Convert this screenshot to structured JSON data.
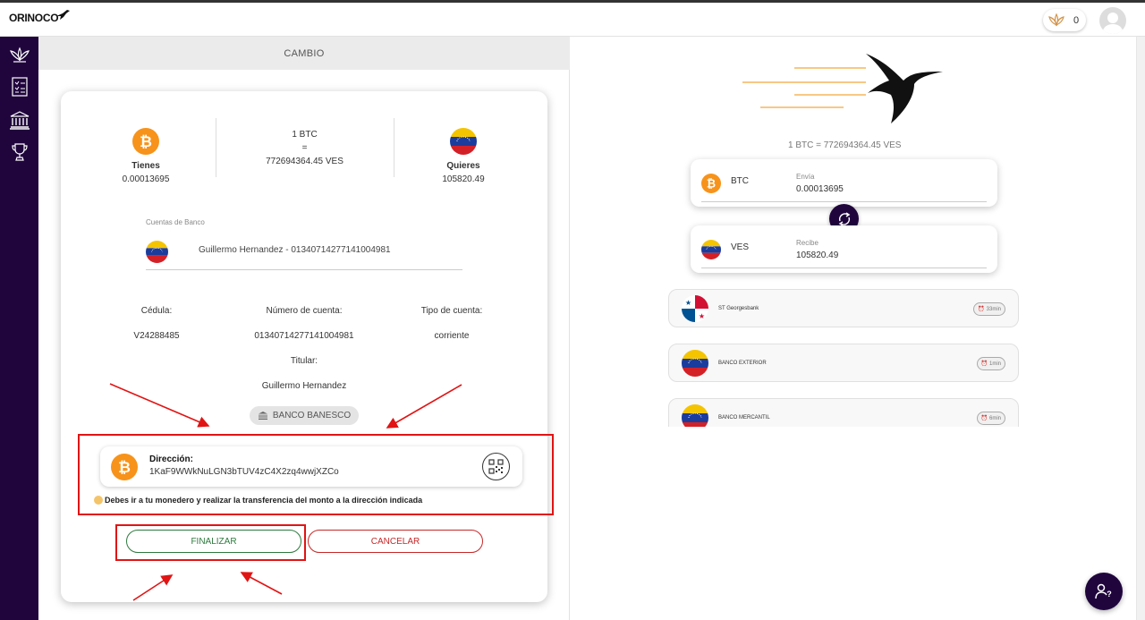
{
  "header": {
    "logo_text": "ORINOCO",
    "coins": "0"
  },
  "sidebar": {
    "items": [
      {
        "icon": "lotus-icon"
      },
      {
        "icon": "checklist-icon"
      },
      {
        "icon": "bank-icon"
      },
      {
        "icon": "trophy-icon"
      }
    ]
  },
  "exchange": {
    "section_title": "CAMBIO",
    "have_label": "Tienes",
    "have_amount": "0.00013695",
    "rate_line1": "1 BTC",
    "rate_equals": "=",
    "rate_line2": "772694364.45 VES",
    "want_label": "Quieres",
    "want_amount": "105820.49",
    "bank_accounts_label": "Cuentas de Banco",
    "selected_account": "Guillermo Hernandez - 01340714277141004981",
    "cedula_label": "Cédula:",
    "cedula_value": "V24288485",
    "account_number_label": "Número de cuenta:",
    "account_number_value": "01340714277141004981",
    "account_type_label": "Tipo de cuenta:",
    "account_type_value": "corriente",
    "holder_label": "Titular:",
    "holder_value": "Guillermo Hernandez",
    "bank_name": "BANCO BANESCO",
    "address_title": "Dirección:",
    "address_value": "1KaF9WWkNuLGN3bTUV4zC4X2zq4wwjXZCo",
    "warning": "Debes ir a tu monedero y realizar la transferencia del monto a la dirección indicada",
    "finish_label": "FINALIZAR",
    "cancel_label": "CANCELAR"
  },
  "converter": {
    "rate": "1 BTC = 772694364.45 VES",
    "send_currency": "BTC",
    "send_label": "Envía",
    "send_amount": "0.00013695",
    "receive_currency": "VES",
    "receive_label": "Recibe",
    "receive_amount": "105820.49"
  },
  "banks": [
    {
      "name": "ST Georgesbank",
      "time": "33min",
      "flag": "panama"
    },
    {
      "name": "BANCO EXTERIOR",
      "time": "1min",
      "flag": "venezuela"
    },
    {
      "name": "BANCO MERCANTIL",
      "time": "6min",
      "flag": "venezuela"
    }
  ],
  "colors": {
    "brand_dark": "#20053d",
    "btc_orange": "#f7931a",
    "finish_green": "#2d7a3e",
    "cancel_red": "#c62828",
    "annotation_red": "#e11414"
  }
}
